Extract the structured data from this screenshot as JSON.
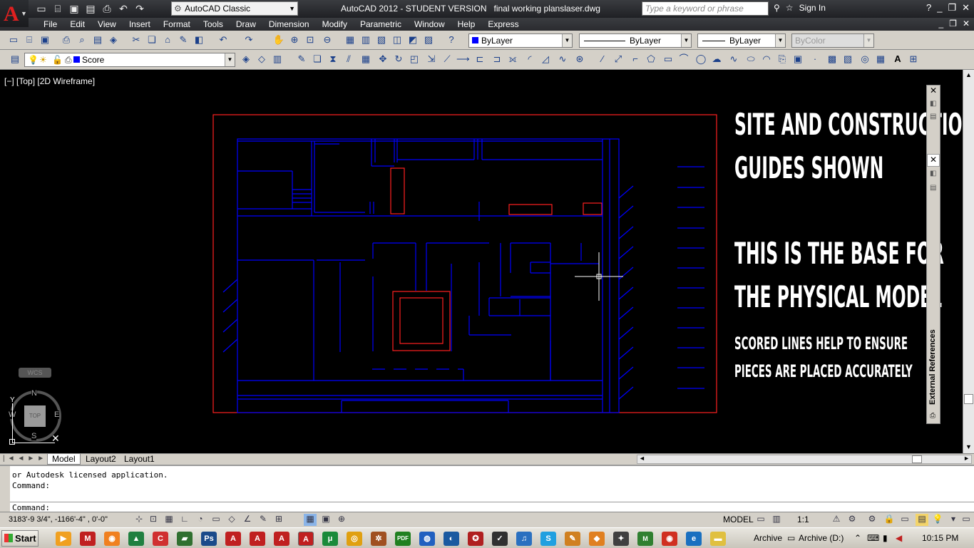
{
  "app": {
    "title": "AutoCAD 2012 - STUDENT VERSION   final working planslaser.dwg",
    "workspace": "AutoCAD Classic",
    "search_placeholder": "Type a keyword or phrase",
    "sign_in": "Sign In",
    "brand_color": "#e02020"
  },
  "menu": [
    "File",
    "Edit",
    "View",
    "Insert",
    "Format",
    "Tools",
    "Draw",
    "Dimension",
    "Modify",
    "Parametric",
    "Window",
    "Help",
    "Express"
  ],
  "properties": {
    "color": "ByLayer",
    "linetype": "ByLayer",
    "lineweight": "ByLayer",
    "plotstyle": "ByColor"
  },
  "layer": {
    "name": "Score",
    "swatch": "#0000ff"
  },
  "viewport": {
    "label": "[−] [Top] [2D Wireframe]"
  },
  "notes": {
    "line1": "SITE AND CONSTRUCTION",
    "line2": "GUIDES SHOWN",
    "line3": "THIS IS THE BASE FOR",
    "line4": "THE PHYSICAL MODEL",
    "line5": "SCORED LINES HELP TO ENSURE",
    "line6": "PIECES ARE PLACED ACCURATELY"
  },
  "viewcube": {
    "n": "N",
    "s": "S",
    "e": "E",
    "w": "W",
    "top": "TOP",
    "wcs": "WCS",
    "y": "Y"
  },
  "palette": {
    "title": "External References"
  },
  "layout_tabs": [
    "Model",
    "Layout2",
    "Layout1"
  ],
  "command": {
    "line1": "or Autodesk licensed application.",
    "line2": "Command:",
    "prompt": "Command:"
  },
  "status": {
    "coords": "3183'-9 3/4\", -1166'-4\"  , 0'-0\"",
    "model": "MODEL",
    "scale": "1:1"
  },
  "taskbar": {
    "start": "Start",
    "archive1": "Archive",
    "archive2": "Archive (D:)",
    "time": "10:15 PM"
  }
}
